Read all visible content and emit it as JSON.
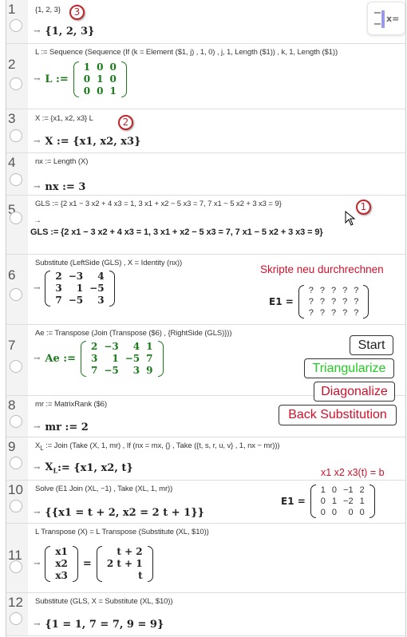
{
  "rows": [
    {
      "num": "1",
      "input": "{1, 2, 3}",
      "output": "{1, 2, 3}"
    },
    {
      "num": "2",
      "input": "L := Sequence (Sequence (If (k = Element ($1, j) , 1, 0) , j, 1, Length ($1)) , k, 1, Length ($1))",
      "output_label": "L :=",
      "matrix": [
        [
          "1",
          "0",
          "0"
        ],
        [
          "0",
          "1",
          "0"
        ],
        [
          "0",
          "0",
          "1"
        ]
      ]
    },
    {
      "num": "3",
      "input": "X := {x1, x2, x3}  L",
      "output": "X := {x1, x2, x3}"
    },
    {
      "num": "4",
      "input": "nx := Length (X)",
      "output": "nx := 3"
    },
    {
      "num": "5",
      "input": "GLS := {2 x1 − 3 x2 + 4 x3 = 1, 3 x1 + x2 − 5 x3 = 7, 7 x1 − 5 x2 + 3 x3 = 9}",
      "output": "GLS := {2 x1 − 3 x2 + 4 x3 = 1, 3 x1 + x2 − 5 x3 = 7, 7 x1 − 5 x2 + 3 x3 = 9}"
    },
    {
      "num": "6",
      "input": "Substitute (LeftSide (GLS) , X = Identity (nx))",
      "matrix": [
        [
          "2",
          "−3",
          "4"
        ],
        [
          "3",
          "1",
          "−5"
        ],
        [
          "7",
          "−5",
          "3"
        ]
      ]
    },
    {
      "num": "7",
      "input": "Ae := Transpose (Join (Transpose ($6) , {RightSide (GLS)}))",
      "output_label": "Ae :=",
      "matrix": [
        [
          "2",
          "−3",
          "4",
          "1"
        ],
        [
          "3",
          "1",
          "−5",
          "7"
        ],
        [
          "7",
          "−5",
          "3",
          "9"
        ]
      ]
    },
    {
      "num": "8",
      "input": "mr := MatrixRank ($6)",
      "output": "mr := 2"
    },
    {
      "num": "9",
      "input_pre": "X",
      "input_sub": "L",
      "input": " := Join (Take (X, 1, mr) , If (nx = mx, {} , Take ({t, s, r, u, v} , 1, nx − mr)))",
      "output_pre": "X",
      "output_sub": "L",
      "output": " := {x1, x2, t}"
    },
    {
      "num": "10",
      "input": "Solve (E1 Join (XL, −1) , Take (XL, 1, mr))",
      "output": "{{x1 = t + 2, x2 = 2 t + 1}}"
    },
    {
      "num": "11",
      "input": "L Transpose (X) = L Transpose (Substitute (XL, $10))",
      "lhs": [
        [
          "x1"
        ],
        [
          "x2"
        ],
        [
          "x3"
        ]
      ],
      "eq": "=",
      "rhs": [
        [
          "t + 2"
        ],
        [
          "2 t + 1"
        ],
        [
          "t"
        ]
      ]
    },
    {
      "num": "12",
      "input": "Substitute (GLS, X = Substitute (XL, $10))",
      "output": "{1 = 1, 7 = 7, 9 = 9}"
    }
  ],
  "annotations": [
    "3",
    "2",
    "1"
  ],
  "toggle": {
    "label": "x="
  },
  "recompute_text": "Skripte neu durchrechnen",
  "e1_top": {
    "label": "E1 =",
    "matrix": [
      [
        "?",
        "?",
        "?",
        "?",
        "?"
      ],
      [
        "?",
        "?",
        "?",
        "?",
        "?"
      ],
      [
        "?",
        "?",
        "?",
        "?",
        "?"
      ]
    ]
  },
  "buttons": {
    "start": "Start",
    "triangularize": "Triangularize",
    "diagonalize": "Diagonalize",
    "back_substitution": "Back Substitution"
  },
  "buttons_colors": {
    "start": "#222222",
    "triangularize": "#22cc22",
    "diagonalize": "#d0102a",
    "back_substitution": "#d0102a"
  },
  "legend_text": "x1 x2  x3(t) = b",
  "e1_bottom": {
    "label": "E1 =",
    "matrix": [
      [
        "1",
        "0",
        "−1",
        "2"
      ],
      [
        "0",
        "1",
        "−2",
        "1"
      ],
      [
        "0",
        "0",
        "0",
        "0"
      ]
    ]
  }
}
